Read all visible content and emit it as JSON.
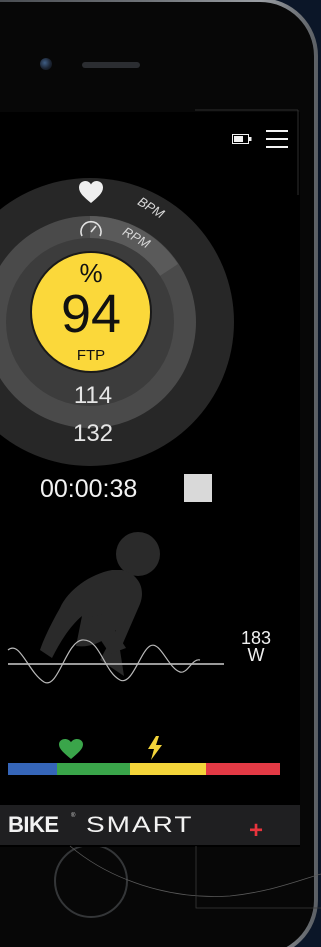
{
  "gauge": {
    "ring_labels": [
      "BPM",
      "RPM"
    ],
    "ftp_percent_symbol": "%",
    "ftp_value": "94",
    "ftp_label": "FTP",
    "rpm_value": "114",
    "bpm_value": "132"
  },
  "workout": {
    "elapsed_time": "00:00:38",
    "power_value": "183",
    "power_unit": "W"
  },
  "zones": [
    {
      "color": "#3565b8"
    },
    {
      "color": "#3aa54a"
    },
    {
      "color": "#f4d53a"
    },
    {
      "color": "#e33a45"
    }
  ],
  "brand": {
    "bike": "BIKE",
    "registered": "®",
    "smart": "SMART",
    "plus": "+"
  },
  "colors": {
    "ftp_yellow": "#fbd83a",
    "brand_red": "#e8343d"
  },
  "icons": [
    "battery-icon",
    "menu-icon",
    "heart-icon",
    "speedometer-icon",
    "stop-icon",
    "lightning-icon",
    "zone-heart-icon"
  ]
}
